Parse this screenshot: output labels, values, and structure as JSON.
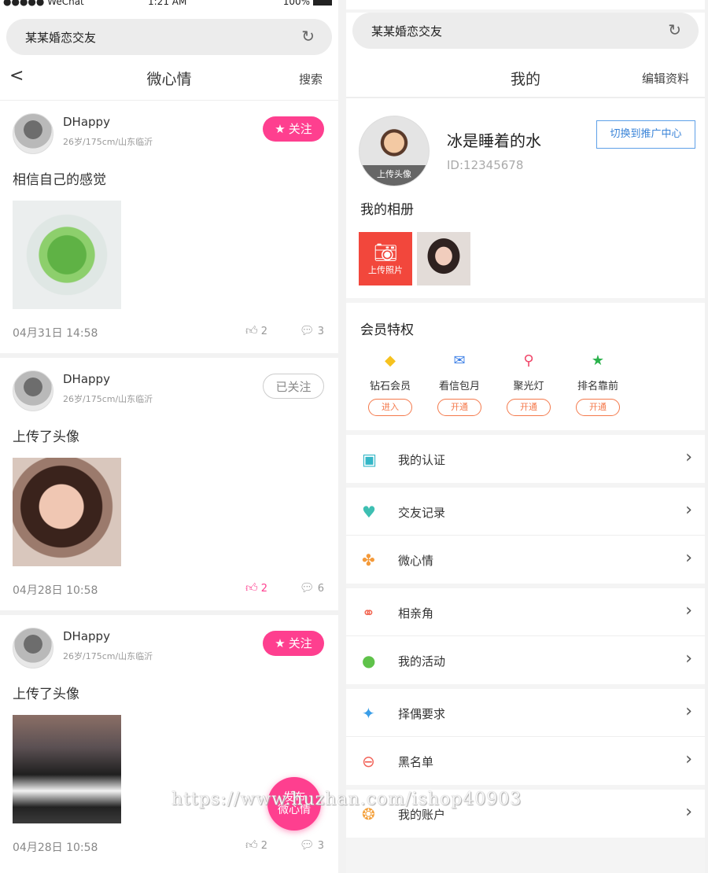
{
  "left": {
    "status": {
      "carrier": "●●●●● WeChat",
      "time": "1:21 AM",
      "battery": "100%"
    },
    "address_title": "某某婚恋交友",
    "nav": {
      "back": "<",
      "title": "微心情",
      "right": "搜索"
    },
    "posts": [
      {
        "name": "DHappy",
        "meta": "26岁/175cm/山东临沂",
        "follow": "关注",
        "text": "相信自己的感觉",
        "time": "04月31日 14:58",
        "likes": "2",
        "comments": "3"
      },
      {
        "name": "DHappy",
        "meta": "26岁/175cm/山东临沂",
        "follow": "已关注",
        "text": "上传了头像",
        "time": "04月28日 10:58",
        "likes": "2",
        "comments": "6"
      },
      {
        "name": "DHappy",
        "meta": "26岁/175cm/山东临沂",
        "follow": "关注",
        "text": "上传了头像",
        "time": "04月28日 10:58",
        "likes": "2",
        "comments": "3"
      }
    ],
    "fab": {
      "line1": "发布",
      "line2": "微心情"
    }
  },
  "right": {
    "address_title": "某某婚恋交友",
    "nav": {
      "title": "我的",
      "right": "编辑资料"
    },
    "profile": {
      "name": "冰是睡着的水",
      "id": "ID:12345678",
      "avatar_label": "上传头像",
      "switch": "切换到推广中心"
    },
    "album": {
      "title": "我的相册",
      "upload": "上传照片"
    },
    "vip": {
      "title": "会员特权",
      "items": [
        {
          "icon": "diamond-icon",
          "label": "钻石会员",
          "btn": "进入"
        },
        {
          "icon": "mail-icon",
          "label": "看信包月",
          "btn": "开通"
        },
        {
          "icon": "spotlight-icon",
          "label": "聚光灯",
          "btn": "开通"
        },
        {
          "icon": "star-icon",
          "label": "排名靠前",
          "btn": "开通"
        }
      ]
    },
    "menu_groups": [
      [
        {
          "icon": "id-card-icon",
          "label": "我的认证"
        }
      ],
      [
        {
          "icon": "handshake-icon",
          "label": "交友记录"
        },
        {
          "icon": "pinwheel-icon",
          "label": "微心情"
        }
      ],
      [
        {
          "icon": "couple-icon",
          "label": "相亲角"
        },
        {
          "icon": "balloons-icon",
          "label": "我的活动"
        }
      ],
      [
        {
          "icon": "magic-wand-icon",
          "label": "择偶要求"
        },
        {
          "icon": "blocked-user-icon",
          "label": "黑名单"
        }
      ],
      [
        {
          "icon": "wallet-icon",
          "label": "我的账户"
        }
      ]
    ]
  },
  "watermark": "https://www.huzhan.com/ishop40903",
  "colors": {
    "accent_pink": "#fe3f8f",
    "orange": "#f4794b",
    "switch_blue": "#3a84d8",
    "upload_red": "#f2473c"
  }
}
